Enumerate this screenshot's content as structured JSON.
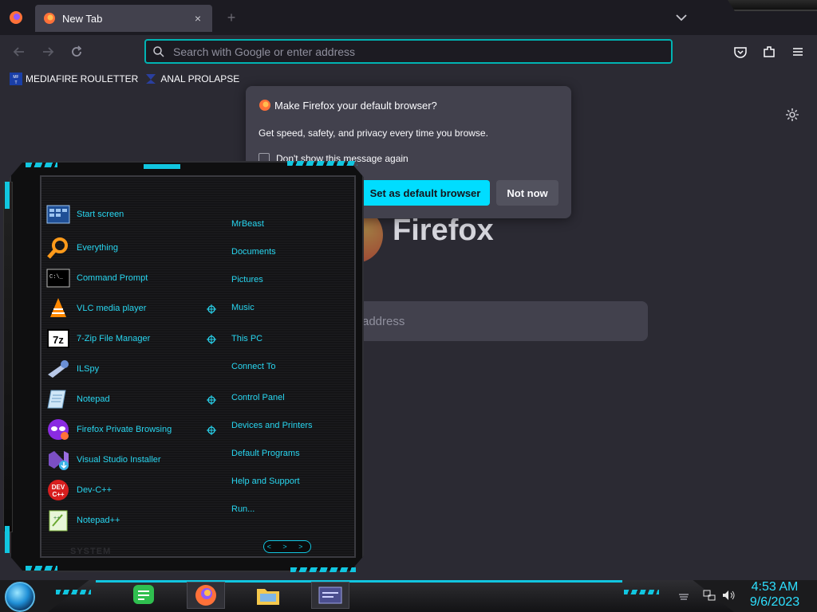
{
  "browser": {
    "tab": {
      "title": "New Tab",
      "close": "×"
    },
    "new_tab": "+",
    "urlbar": {
      "placeholder": "Search with Google or enter address"
    },
    "bookmarks": [
      {
        "label": "MEDIAFIRE ROULETTER",
        "icon": "mediafire-icon"
      },
      {
        "label": "ANAL PROLAPSE",
        "icon": "bookmark-icon"
      }
    ],
    "newtab": {
      "logo_text": "Firefox",
      "search_placeholder": "address"
    }
  },
  "popup": {
    "title": "Make Firefox your default browser?",
    "message": "Get speed, safety, and privacy every time you browse.",
    "checkbox_label": "Don't show this message again",
    "primary_button": "Set as default browser",
    "secondary_button": "Not now"
  },
  "start_menu": {
    "programs": [
      {
        "label": "Start screen",
        "icon": "start-screen-icon"
      },
      {
        "label": "Everything",
        "icon": "magnifier-icon"
      },
      {
        "label": "Command Prompt",
        "icon": "cmd-icon"
      },
      {
        "label": "VLC media player",
        "icon": "vlc-icon"
      },
      {
        "label": "7-Zip File Manager",
        "icon": "7zip-icon"
      },
      {
        "label": "ILSpy",
        "icon": "ilspy-icon"
      },
      {
        "label": "Notepad",
        "icon": "notepad-icon"
      },
      {
        "label": "Firefox Private Browsing",
        "icon": "firefox-private-icon"
      },
      {
        "label": "Visual Studio Installer",
        "icon": "vs-installer-icon"
      },
      {
        "label": "Dev-C++",
        "icon": "devcpp-icon"
      },
      {
        "label": "Notepad++",
        "icon": "notepadpp-icon"
      }
    ],
    "system_links": [
      "MrBeast",
      "Documents",
      "Pictures",
      "Music",
      "This PC",
      "Connect To",
      "Control Panel",
      "Devices and Printers",
      "Default Programs",
      "Help and Support",
      "Run..."
    ],
    "system_label": "SYSTEM",
    "arrows": "< > >"
  },
  "taskbar": {
    "apps": [
      "notes-app-icon",
      "firefox-icon",
      "file-explorer-icon",
      "window-app-icon"
    ],
    "time": "4:53 AM",
    "date": "9/6/2023"
  },
  "colors": {
    "accent_cyan": "#11c6e0",
    "label_cyan": "#28d6f0",
    "urlbar_focus": "#00b3b3",
    "primary_button": "#00ddff"
  }
}
